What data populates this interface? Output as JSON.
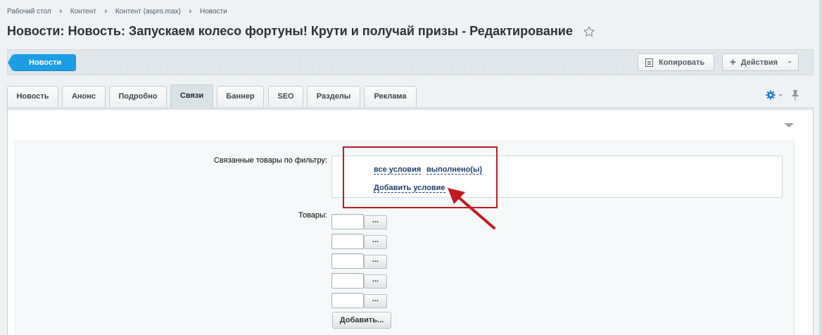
{
  "breadcrumb": [
    "Рабочий стол",
    "Контент",
    "Контент (aspro.max)",
    "Новости"
  ],
  "page_title": "Новости: Новость: Запускаем колесо фортуны! Крути и получай призы - Редактирование",
  "toolbar": {
    "back_label": "Новости",
    "copy_label": "Копировать",
    "actions_label": "Действия"
  },
  "tabs": [
    {
      "label": "Новость"
    },
    {
      "label": "Анонс"
    },
    {
      "label": "Подробно"
    },
    {
      "label": "Связи",
      "active": true
    },
    {
      "label": "Баннер"
    },
    {
      "label": "SEO"
    },
    {
      "label": "Разделы"
    },
    {
      "label": "Реклама"
    }
  ],
  "form": {
    "filter_label": "Связанные товары по фильтру:",
    "condition": {
      "all": "все условия",
      "done": "выполнено(ы)",
      "add": "Добавить условие"
    },
    "products_label": "Товары:",
    "browse_label": "...",
    "add_button": "Добавить..."
  },
  "colors": {
    "accent": "#1c9de4",
    "annotation": "#c21a20",
    "link": "#1d3f6e"
  },
  "icons": [
    "star-icon",
    "copy-icon",
    "plus-icon",
    "gear-icon",
    "pin-icon",
    "collapse-arrow-icon"
  ]
}
